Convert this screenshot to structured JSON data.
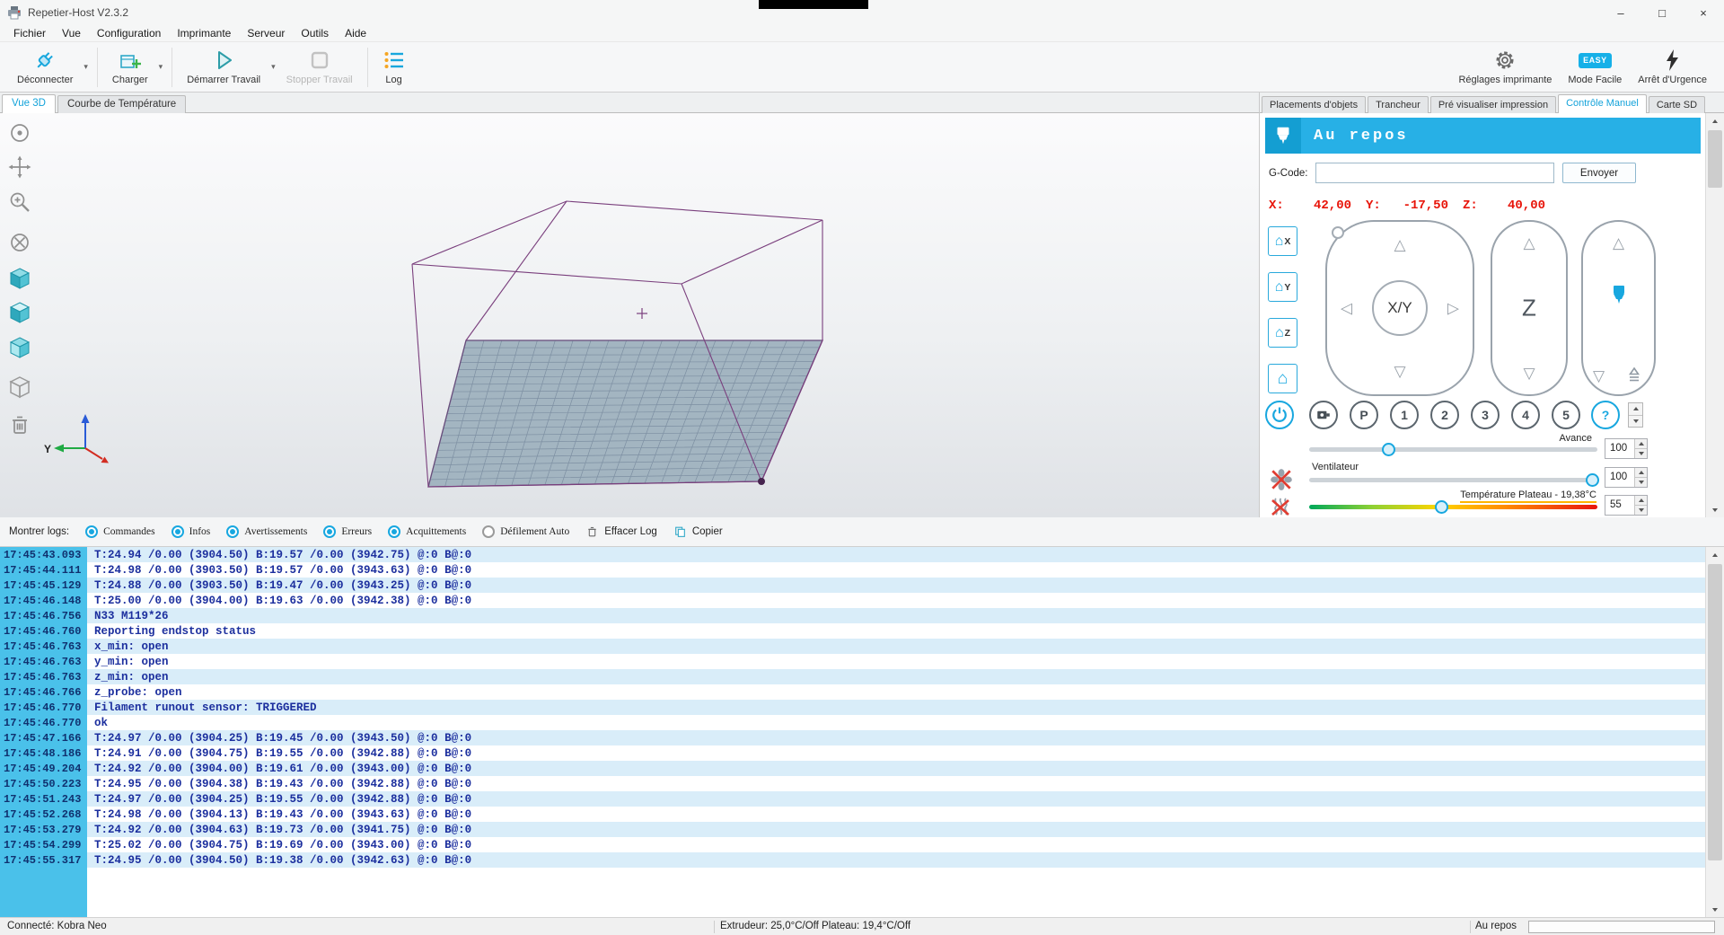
{
  "window": {
    "title": "Repetier-Host V2.3.2",
    "minimize": "–",
    "maximize": "□",
    "close": "×"
  },
  "menu": [
    "Fichier",
    "Vue",
    "Configuration",
    "Imprimante",
    "Serveur",
    "Outils",
    "Aide"
  ],
  "toolbar": {
    "disconnect": "Déconnecter",
    "load": "Charger",
    "start": "Démarrer Travail",
    "stop": "Stopper Travail",
    "log": "Log",
    "settings": "Réglages imprimante",
    "easy_badge": "EASY",
    "easy": "Mode Facile",
    "emergency": "Arrêt d'Urgence"
  },
  "tabs_left": [
    {
      "label": "Vue 3D",
      "active": true
    },
    {
      "label": "Courbe de Température",
      "active": false
    }
  ],
  "tabs_right": [
    {
      "label": "Placements d'objets",
      "active": false
    },
    {
      "label": "Trancheur",
      "active": false
    },
    {
      "label": "Pré visualiser impression",
      "active": false
    },
    {
      "label": "Contrôle Manuel",
      "active": true
    },
    {
      "label": "Carte SD",
      "active": false
    }
  ],
  "viewport": {
    "axis_y": "Y"
  },
  "icons": {
    "home": "⌂",
    "caret_down": "▾",
    "tri_up": "△",
    "tri_down": "▽",
    "tri_left": "◁",
    "tri_right": "▷"
  },
  "manual_control": {
    "status": "Au repos",
    "gcode_label": "G-Code:",
    "gcode_value": "",
    "send": "Envoyer",
    "pos": {
      "xl": "X:",
      "x": "42,00",
      "yl": "Y:",
      "y": "-17,50",
      "zl": "Z:",
      "z": "40,00"
    },
    "home": {
      "x": "X",
      "y": "Y",
      "z": "Z"
    },
    "xy": "X/Y",
    "z": "Z",
    "presets": [
      "P",
      "1",
      "2",
      "3",
      "4",
      "5"
    ],
    "help": "?",
    "feed": {
      "label": "Avance",
      "value": "100"
    },
    "fan": {
      "label": "Ventilateur",
      "value": "100"
    },
    "bed": {
      "label": "Température Plateau - 19,38°C",
      "value": "55"
    }
  },
  "log_bar": {
    "label": "Montrer logs:",
    "toggles": [
      {
        "label": "Commandes",
        "on": true
      },
      {
        "label": "Infos",
        "on": true
      },
      {
        "label": "Avertissements",
        "on": true
      },
      {
        "label": "Erreurs",
        "on": true
      },
      {
        "label": "Acquittements",
        "on": true
      },
      {
        "label": "Défilement Auto",
        "on": false
      }
    ],
    "clear": "Effacer Log",
    "copy": "Copier"
  },
  "log_entries": [
    {
      "time": "17:45:43.093",
      "text": "T:24.94 /0.00 (3904.50) B:19.57 /0.00 (3942.75) @:0 B@:0"
    },
    {
      "time": "17:45:44.111",
      "text": "T:24.98 /0.00 (3903.50) B:19.57 /0.00 (3943.63) @:0 B@:0"
    },
    {
      "time": "17:45:45.129",
      "text": "T:24.88 /0.00 (3903.50) B:19.47 /0.00 (3943.25) @:0 B@:0"
    },
    {
      "time": "17:45:46.148",
      "text": "T:25.00 /0.00 (3904.00) B:19.63 /0.00 (3942.38) @:0 B@:0"
    },
    {
      "time": "17:45:46.756",
      "text": "N33 M119*26"
    },
    {
      "time": "17:45:46.760",
      "text": "Reporting endstop status"
    },
    {
      "time": "17:45:46.763",
      "text": "x_min: open"
    },
    {
      "time": "17:45:46.763",
      "text": "y_min: open"
    },
    {
      "time": "17:45:46.763",
      "text": "z_min: open"
    },
    {
      "time": "17:45:46.766",
      "text": "z_probe: open"
    },
    {
      "time": "17:45:46.770",
      "text": "Filament runout sensor: TRIGGERED"
    },
    {
      "time": "17:45:46.770",
      "text": "ok"
    },
    {
      "time": "17:45:47.166",
      "text": "T:24.97 /0.00 (3904.25) B:19.45 /0.00 (3943.50) @:0 B@:0"
    },
    {
      "time": "17:45:48.186",
      "text": "T:24.91 /0.00 (3904.75) B:19.55 /0.00 (3942.88) @:0 B@:0"
    },
    {
      "time": "17:45:49.204",
      "text": "T:24.92 /0.00 (3904.00) B:19.61 /0.00 (3943.00) @:0 B@:0"
    },
    {
      "time": "17:45:50.223",
      "text": "T:24.95 /0.00 (3904.38) B:19.43 /0.00 (3942.88) @:0 B@:0"
    },
    {
      "time": "17:45:51.243",
      "text": "T:24.97 /0.00 (3904.25) B:19.55 /0.00 (3942.88) @:0 B@:0"
    },
    {
      "time": "17:45:52.268",
      "text": "T:24.98 /0.00 (3904.13) B:19.43 /0.00 (3943.63) @:0 B@:0"
    },
    {
      "time": "17:45:53.279",
      "text": "T:24.92 /0.00 (3904.63) B:19.73 /0.00 (3941.75) @:0 B@:0"
    },
    {
      "time": "17:45:54.299",
      "text": "T:25.02 /0.00 (3904.75) B:19.69 /0.00 (3943.00) @:0 B@:0"
    },
    {
      "time": "17:45:55.317",
      "text": "T:24.95 /0.00 (3904.50) B:19.38 /0.00 (3942.63) @:0 B@:0"
    }
  ],
  "status_bar": {
    "connection": "Connecté: Kobra Neo",
    "temps": "Extrudeur: 25,0°C/Off Plateau: 19,4°C/Off",
    "state": "Au repos"
  },
  "colors": {
    "accent": "#1ca8e0",
    "status_header_bg": "#27b0e6",
    "position_text": "#e81409",
    "log_text": "#1c2f9e",
    "log_gutter": "#4ac1ea",
    "temp_gradient": [
      "#00a85a",
      "#ffd400",
      "#e8150d"
    ]
  }
}
